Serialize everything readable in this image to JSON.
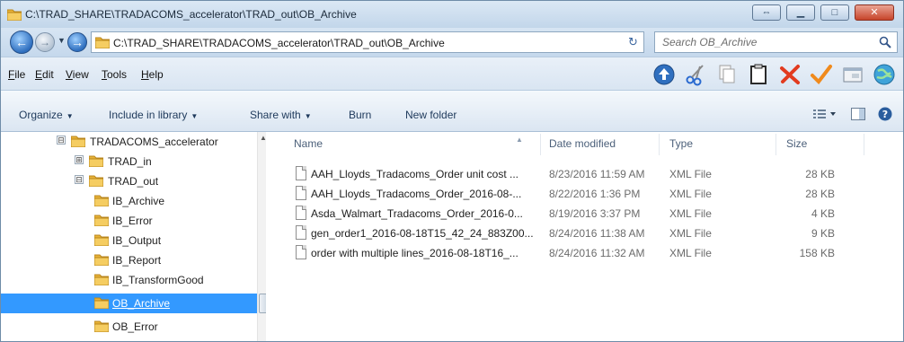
{
  "window": {
    "title": "C:\\TRAD_SHARE\\TRADACOMS_accelerator\\TRAD_out\\OB_Archive"
  },
  "address": {
    "path": "C:\\TRAD_SHARE\\TRADACOMS_accelerator\\TRAD_out\\OB_Archive",
    "search_placeholder": "Search OB_Archive"
  },
  "menu": {
    "items": [
      {
        "accel": "F",
        "rest": "ile"
      },
      {
        "accel": "E",
        "rest": "dit"
      },
      {
        "accel": "V",
        "rest": "iew"
      },
      {
        "accel": "T",
        "rest": "ools"
      },
      {
        "accel": "H",
        "rest": "elp"
      }
    ]
  },
  "commands": {
    "organize": "Organize",
    "include_in_library": "Include in library",
    "share_with": "Share with",
    "burn": "Burn",
    "new_folder": "New folder"
  },
  "tree": [
    {
      "label": "TRADACOMS_accelerator",
      "expander": "⊟"
    },
    {
      "label": "TRAD_in",
      "expander": "⊞"
    },
    {
      "label": "TRAD_out",
      "expander": "⊟"
    },
    {
      "label": "IB_Archive",
      "expander": ""
    },
    {
      "label": "IB_Error",
      "expander": ""
    },
    {
      "label": "IB_Output",
      "expander": ""
    },
    {
      "label": "IB_Report",
      "expander": ""
    },
    {
      "label": "IB_TransformGood",
      "expander": ""
    },
    {
      "label": "OB_Archive",
      "expander": "",
      "selected": true
    },
    {
      "label": "OB_Error",
      "expander": ""
    }
  ],
  "columns": {
    "name": "Name",
    "date_modified": "Date modified",
    "type": "Type",
    "size": "Size"
  },
  "files": [
    {
      "name": "AAH_Lloyds_Tradacoms_Order unit cost ...",
      "date": "8/23/2016 11:59 AM",
      "type": "XML File",
      "size": "28 KB"
    },
    {
      "name": "AAH_Lloyds_Tradacoms_Order_2016-08-...",
      "date": "8/22/2016 1:36 PM",
      "type": "XML File",
      "size": "28 KB"
    },
    {
      "name": "Asda_Walmart_Tradacoms_Order_2016-0...",
      "date": "8/19/2016 3:37 PM",
      "type": "XML File",
      "size": "4 KB"
    },
    {
      "name": "gen_order1_2016-08-18T15_42_24_883Z00...",
      "date": "8/24/2016 11:38 AM",
      "type": "XML File",
      "size": "9 KB"
    },
    {
      "name": "order with multiple lines_2016-08-18T16_...",
      "date": "8/24/2016 11:32 AM",
      "type": "XML File",
      "size": "158 KB"
    }
  ],
  "colors": {
    "selection": "#3399ff",
    "folder": "#e8b339",
    "accent": "#2f6fbf"
  }
}
